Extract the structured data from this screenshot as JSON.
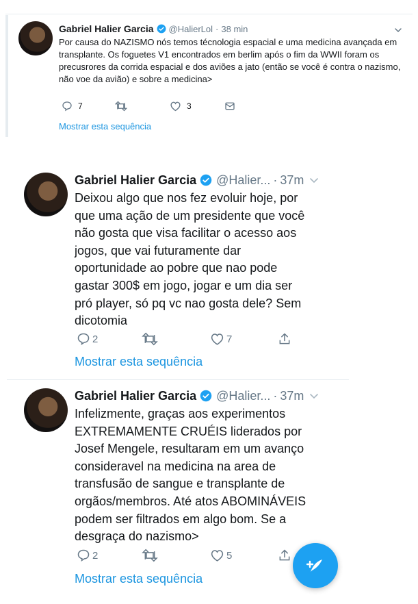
{
  "tweet_top": {
    "name": "Gabriel Halier Garcia",
    "handle": "@HalierLol",
    "dot": "·",
    "time": "38 min",
    "text": "Por causa do NAZISMO nós temos técnologia espacial e uma medicina avançada em transplante. Os foguetes V1 encontrados em berlim após o fim da WWII foram os precusrores da corrida espacial e dos aviões a jato (então se você é contra o nazismo, não voe da avião) e sobre a medicina>",
    "replies": "7",
    "retweets": "",
    "likes": "3",
    "show_thread": "Mostrar esta sequência"
  },
  "tweet_mid": {
    "name": "Gabriel Halier Garcia",
    "handle": "@Halier...",
    "dot": "·",
    "time": "37m",
    "lines": [
      "Deixou algo que nos fez evoluir hoje, por",
      "que uma ação de um presidente que você",
      "não gosta que visa facilitar o acesso aos",
      "jogos, que vai futuramente dar",
      "oportunidade ao pobre que nao pode",
      "gastar 300$ em jogo, jogar e um dia ser",
      "pró player, só pq vc nao gosta dele? Sem",
      "dicotomia"
    ],
    "replies": "2",
    "retweets": "",
    "likes": "7",
    "show_thread": "Mostrar esta sequência"
  },
  "tweet_bottom": {
    "name": "Gabriel Halier Garcia",
    "handle": "@Halier...",
    "dot": "·",
    "time": "37m",
    "lines": [
      "Infelizmente, graças aos experimentos",
      "EXTREMAMENTE CRUÉIS liderados por",
      "Josef Mengele, resultaram em um avanço",
      "consideravel na medicina na area de",
      "transfusão de sangue e transplante de",
      "orgãos/membros. Até atos ABOMINÁVEIS",
      "podem ser filtrados em algo bom. Se a",
      "desgraça do nazismo>"
    ],
    "replies": "2",
    "retweets": "",
    "likes": "5",
    "show_thread": "Mostrar esta sequência"
  },
  "colors": {
    "accent": "#1da1f2",
    "link": "#1b95e0",
    "muted": "#657786",
    "text": "#14171a"
  },
  "icons": [
    "verified-badge-icon",
    "chevron-down-icon",
    "reply-icon",
    "retweet-icon",
    "like-icon",
    "dm-icon",
    "share-icon",
    "compose-tweet-icon"
  ]
}
